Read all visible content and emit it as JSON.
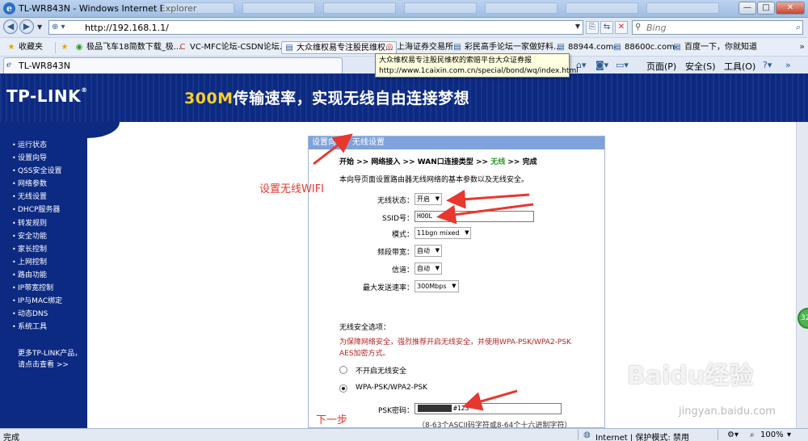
{
  "window": {
    "title": "TL-WR843N - Windows Internet Explorer",
    "buttons": {
      "minimize": "—",
      "maximize": "□",
      "close": "✕"
    }
  },
  "address_bar": {
    "url": "http://192.168.1.1/",
    "search_placeholder": "Bing"
  },
  "favorites": {
    "label": "收藏夹",
    "items": [
      {
        "label": "极品飞车18简数下载_极...",
        "icon": "page-icon"
      },
      {
        "label": "VC-MFC论坛-CSDN论坛...",
        "icon": "csdn-icon"
      },
      {
        "label": "大众维权易专注股民维权...",
        "icon": "page-icon"
      },
      {
        "label": "上海证券交易所",
        "icon": "sse-icon"
      },
      {
        "label": "彩民高手论坛一家做好料...",
        "icon": "page-icon"
      },
      {
        "label": "88944.com-",
        "icon": "page-icon"
      },
      {
        "label": "88600c.com-",
        "icon": "page-icon"
      },
      {
        "label": "百度一下，你就知道",
        "icon": "baidu-icon"
      }
    ]
  },
  "tooltip": {
    "line1": "大众维权易专注股民维权的索赔平台大众证券报",
    "line2": "http://www.1caixin.com.cn/special/bond/wq/index.html"
  },
  "tab": {
    "label": "TL-WR843N"
  },
  "command_bar": {
    "page": "页面(P)",
    "safety": "安全(S)",
    "tools": "工具(O)"
  },
  "banner": {
    "logo": "TP-LINK",
    "slogan_highlight": "300M",
    "slogan_rest": "传输速率，实现无线自由连接梦想"
  },
  "sidebar": {
    "items": [
      "运行状态",
      "设置向导",
      "QSS安全设置",
      "网络参数",
      "无线设置",
      "DHCP服务器",
      "转发规则",
      "安全功能",
      "家长控制",
      "上网控制",
      "路由功能",
      "IP带宽控制",
      "IP与MAC绑定",
      "动态DNS",
      "系统工具"
    ],
    "more_line1": "更多TP-LINK产品，",
    "more_line2": "请点击查看 >>"
  },
  "panel": {
    "header": "设置向导 - 无线设置",
    "steps": {
      "s1": "开始",
      "s2": "网络接入",
      "s3": "WAN口连接类型",
      "s4": "无线",
      "s5": "完成",
      "sep": ">>"
    },
    "intro": "本向导页面设置路由器无线网络的基本参数以及无线安全。",
    "fields": {
      "wireless_status": {
        "label": "无线状态：",
        "value": "开启"
      },
      "ssid": {
        "label": "SSID号：",
        "value": "HOOL"
      },
      "mode": {
        "label": "模式：",
        "value": "11bgn mixed"
      },
      "bandwidth": {
        "label": "频段带宽：",
        "value": "自动"
      },
      "channel": {
        "label": "信道：",
        "value": "自动"
      },
      "max_rate": {
        "label": "最大发送速率：",
        "value": "300Mbps"
      }
    },
    "security_title": "无线安全选项：",
    "security_warning": "为保障网络安全，强烈推荐开启无线安全，并使用WPA-PSK/WPA2-PSK AES加密方式。",
    "option_off": "不开启无线安全",
    "option_wpa": "WPA-PSK/WPA2-PSK",
    "psk_label": "PSK密码：",
    "psk_visible": "#123",
    "psk_hint": "（8-63个ASCII码字符或8-64个十六进制字符）"
  },
  "annotations": {
    "set_wifi": "设置无线WIFI",
    "next_step": "下一步"
  },
  "floating_badge": "32",
  "watermark": {
    "logo": "Baidu经验",
    "site": "jingyan.baidu.com"
  },
  "status_bar": {
    "left": "完成",
    "zone": "Internet | 保护模式: 禁用",
    "zoom": "100%"
  },
  "colors": {
    "banner_bg": "#0c2a82",
    "panel_header": "#7fa2dc",
    "annotation_red": "#e8372f",
    "current_step_green": "#2a9d2a"
  }
}
